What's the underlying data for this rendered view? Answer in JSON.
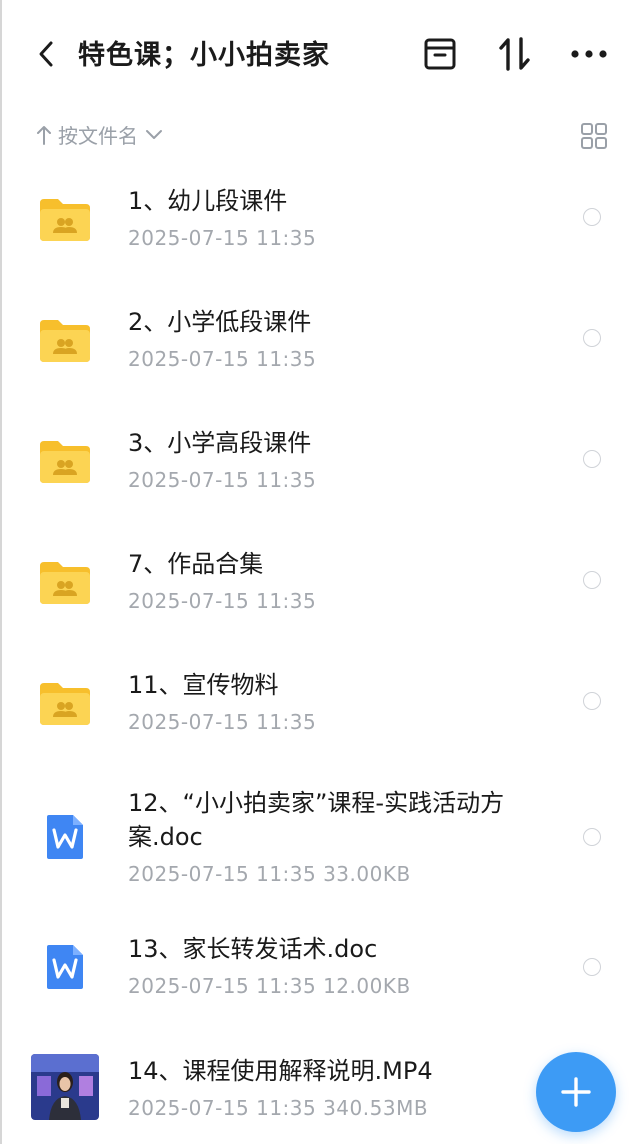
{
  "header": {
    "title": "特色课；小小拍卖家",
    "back_icon": "chevron-left-icon",
    "actions": [
      "archive-box-icon",
      "sort-arrows-icon",
      "more-dots-icon"
    ]
  },
  "sort": {
    "label": "按文件名",
    "direction_icon": "arrow-up-icon",
    "dropdown_icon": "chevron-down-icon",
    "view_toggle_icon": "grid-view-icon"
  },
  "files": [
    {
      "name": "1、幼儿段课件",
      "meta": "2025-07-15  11:35",
      "type": "shared-folder"
    },
    {
      "name": "2、小学低段课件",
      "meta": "2025-07-15  11:35",
      "type": "shared-folder"
    },
    {
      "name": "3、小学高段课件",
      "meta": "2025-07-15  11:35",
      "type": "shared-folder"
    },
    {
      "name": "7、作品合集",
      "meta": "2025-07-15  11:35",
      "type": "shared-folder"
    },
    {
      "name": "11、宣传物料",
      "meta": "2025-07-15  11:35",
      "type": "shared-folder"
    },
    {
      "name_line1": "12、“小小拍卖家”课程-实践活动方",
      "name_line2": "案.doc",
      "meta": "2025-07-15  11:35  33.00KB",
      "type": "word-doc"
    },
    {
      "name": "13、家长转发话术.doc",
      "meta": "2025-07-15  11:35  12.00KB",
      "type": "word-doc"
    },
    {
      "name": "14、课程使用解释说明.MP4",
      "meta": "2025-07-15  11:35  340.53MB",
      "type": "video"
    }
  ],
  "fab": {
    "icon": "plus-icon"
  },
  "colors": {
    "accent": "#3d9bf5",
    "folder": "#fcd14a",
    "word": "#3f86f3",
    "muted_text": "#a4a8ae"
  }
}
